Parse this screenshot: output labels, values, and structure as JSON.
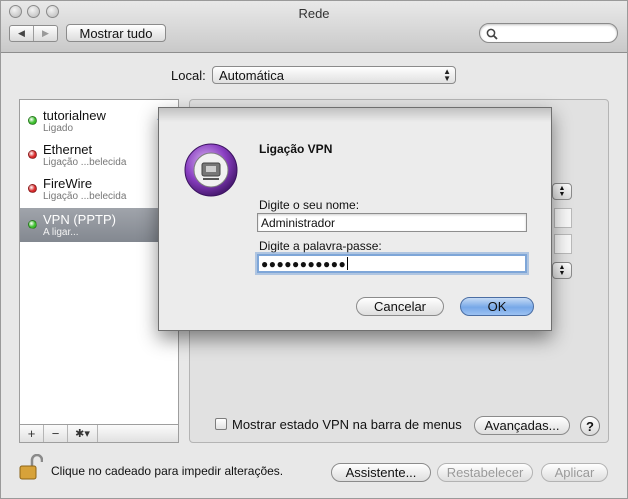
{
  "window": {
    "title": "Rede"
  },
  "toolbar": {
    "back_label": "◀",
    "forward_label": "▶",
    "show_all_label": "Mostrar tudo",
    "search_value": ""
  },
  "location": {
    "label": "Local:",
    "value": "Automática"
  },
  "services": [
    {
      "name": "tutorialnew",
      "status": "Ligado",
      "dot_color": "#3cbf2d"
    },
    {
      "name": "Ethernet",
      "status": "Ligação ...belecida",
      "dot_color": "#d9292a"
    },
    {
      "name": "FireWire",
      "status": "Ligação ...belecida",
      "dot_color": "#d9292a"
    },
    {
      "name": "VPN (PPTP)",
      "status": "A ligar...",
      "dot_color": "#3cbf2d",
      "selected": true
    }
  ],
  "sidebar_tools": {
    "add": "+",
    "remove": "−",
    "gear": "✱▾"
  },
  "detail": {
    "show_vpn_status_label": "Mostrar estado VPN na barra de menus",
    "advanced_label": "Avançadas...",
    "help_label": "?"
  },
  "lock": {
    "text": "Clique no cadeado para impedir alterações."
  },
  "footer": {
    "assistant_label": "Assistente...",
    "revert_label": "Restabelecer",
    "apply_label": "Aplicar"
  },
  "dialog": {
    "title": "Ligação VPN",
    "name_label": "Digite o seu nome:",
    "name_value": "Administrador",
    "password_label": "Digite a palavra-passe:",
    "password_mask": "●●●●●●●●●●●",
    "cancel_label": "Cancelar",
    "ok_label": "OK"
  },
  "colors": {
    "selection": "#8b9098",
    "default_button": "#77a8e8",
    "focus_ring": "#7ea6d8"
  }
}
